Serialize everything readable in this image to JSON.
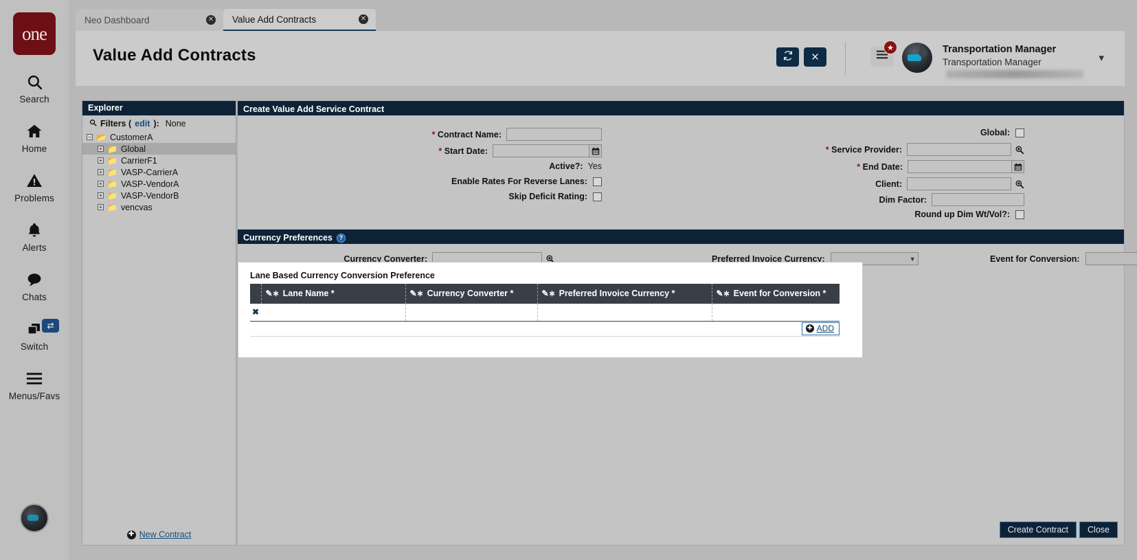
{
  "brand": {
    "logo_text": "one"
  },
  "rail": {
    "items": [
      {
        "label": "Search",
        "icon": "search-icon"
      },
      {
        "label": "Home",
        "icon": "home-icon"
      },
      {
        "label": "Problems",
        "icon": "warning-triangle-icon"
      },
      {
        "label": "Alerts",
        "icon": "bell-icon"
      },
      {
        "label": "Chats",
        "icon": "chat-bubble-icon"
      },
      {
        "label": "Switch",
        "icon": "windows-stack-icon",
        "badge_icon": "swap-arrows-icon"
      },
      {
        "label": "Menus/Favs",
        "icon": "hamburger-icon"
      }
    ]
  },
  "tabs": [
    {
      "label": "Neo Dashboard",
      "active": false
    },
    {
      "label": "Value Add Contracts",
      "active": true
    }
  ],
  "header": {
    "title": "Value Add Contracts",
    "refresh_icon": "refresh-icon",
    "close_icon": "close-x-icon",
    "menu_icon": "hamburger-menu-icon",
    "star_icon": "star-icon",
    "user_name": "Transportation Manager",
    "user_role": "Transportation Manager",
    "caret_icon": "chevron-down-icon"
  },
  "explorer": {
    "title": "Explorer",
    "filters_label": "Filters (",
    "filters_edit": "edit",
    "filters_label_end": "):",
    "filters_value": "None",
    "root": {
      "label": "CustomerA",
      "expander": "−"
    },
    "nodes": [
      {
        "label": "Global",
        "selected": true
      },
      {
        "label": "CarrierF1",
        "selected": false
      },
      {
        "label": "VASP-CarrierA",
        "selected": false
      },
      {
        "label": "VASP-VendorA",
        "selected": false
      },
      {
        "label": "VASP-VendorB",
        "selected": false
      },
      {
        "label": "vencvas",
        "selected": false
      }
    ],
    "new_contract_label": "New Contract"
  },
  "main": {
    "section_title": "Create Value Add Service Contract",
    "fields_left": [
      {
        "label": "Contract Name:",
        "required": true,
        "type": "text",
        "value": ""
      },
      {
        "label": "Start Date:",
        "required": true,
        "type": "date",
        "value": "",
        "icon": "calendar-icon"
      },
      {
        "label": "Active?:",
        "required": false,
        "type": "static",
        "value": "Yes"
      },
      {
        "label": "Enable Rates For Reverse Lanes:",
        "required": false,
        "type": "checkbox",
        "checked": false
      },
      {
        "label": "Skip Deficit Rating:",
        "required": false,
        "type": "checkbox",
        "checked": false
      }
    ],
    "fields_right": [
      {
        "label": "Global:",
        "required": false,
        "type": "checkbox",
        "checked": false
      },
      {
        "label": "Service Provider:",
        "required": true,
        "type": "lookup",
        "value": "",
        "icon": "magnifier-icon"
      },
      {
        "label": "End Date:",
        "required": true,
        "type": "date",
        "value": "",
        "icon": "calendar-icon"
      },
      {
        "label": "Client:",
        "required": false,
        "type": "lookup",
        "value": "",
        "icon": "magnifier-icon"
      },
      {
        "label": "Dim Factor:",
        "required": false,
        "type": "text",
        "value": ""
      },
      {
        "label": "Round up Dim Wt/Vol?:",
        "required": false,
        "type": "checkbox",
        "checked": false
      }
    ],
    "currency": {
      "section_title": "Currency Preferences",
      "help_icon": "help-icon",
      "converter_label": "Currency Converter:",
      "converter_value": "",
      "converter_icon": "magnifier-icon",
      "preferred_invoice_label": "Preferred Invoice Currency:",
      "preferred_invoice_value": "",
      "event_conversion_label": "Event for Conversion:",
      "event_conversion_value": ""
    },
    "lane_table": {
      "caption": "Lane Based Currency Conversion Preference",
      "columns": [
        {
          "label": "Lane Name *",
          "edit_icon": "edit-pencil-icon"
        },
        {
          "label": "Currency Converter *",
          "edit_icon": "edit-pencil-icon"
        },
        {
          "label": "Preferred Invoice Currency *",
          "edit_icon": "edit-pencil-icon"
        },
        {
          "label": "Event for Conversion *",
          "edit_icon": "edit-pencil-icon"
        }
      ],
      "rows": [
        {
          "delete_icon": "delete-x-icon",
          "cells": [
            "",
            "",
            "",
            ""
          ]
        }
      ],
      "add_label": "ADD",
      "add_icon": "plus-circle-icon"
    },
    "footer": {
      "create_label": "Create Contract",
      "close_label": "Close"
    }
  },
  "colors": {
    "brand_red": "#6d0f14",
    "section_header": "#0d2237",
    "table_header": "#3a3f47",
    "link_blue": "#14507d",
    "required_red": "#8b1a1a",
    "page_bg": "#b8b8b8",
    "panel_bg": "#c4c4c4"
  }
}
